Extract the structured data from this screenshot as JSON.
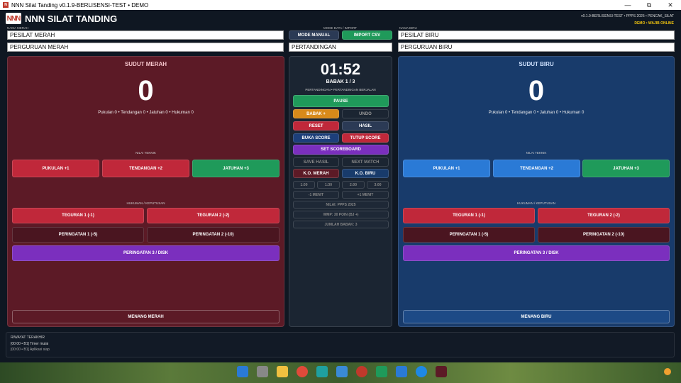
{
  "window": {
    "title": "NNN Silat Tanding v0.1.9-BERLISENSI-TEST • DEMO",
    "min": "—",
    "max": "⧉",
    "close": "✕"
  },
  "header": {
    "logo": "NNN",
    "app_name": "NNN SILAT TANDING",
    "meta1": "v0.1.9-BERLISENSI-TEST • PPPS 2025 • PENCAK_SILAT",
    "meta2": "DEMO • WAJIB ONLINE"
  },
  "left_fields": {
    "label": "NAMA MERAH",
    "name": "PESILAT MERAH",
    "club": "PERGURUAN MERAH"
  },
  "right_fields": {
    "label": "NAMA BIRU",
    "name": "PESILAT BIRU",
    "club": "PERGURUAN BIRU"
  },
  "mode": {
    "label": "MODE DATA / IMPORT",
    "manual": "MODE MANUAL",
    "import": "IMPORT CSV",
    "event": "PERTANDINGAN"
  },
  "red": {
    "title": "SUDUT MERAH",
    "score": "0",
    "stats": "Pukulan 0  •  Tendangan 0  •  Jatuhan 0  •  Hukuman 0",
    "teknik_label": "NILAI TEKNIK",
    "pukulan": "PUKULAN +1",
    "tendangan": "TENDANGAN +2",
    "jatuhan": "JATUHAN +3",
    "hukuman_label": "HUKUMAN / KEPUTUSAN",
    "teguran1": "TEGURAN 1  (-1)",
    "teguran2": "TEGURAN 2  (-2)",
    "peringatan1": "PERINGATAN 1  (-5)",
    "peringatan2": "PERINGATAN 2  (-10)",
    "peringatan3": "PERINGATAN 3 / DISK",
    "menang": "MENANG MERAH"
  },
  "blue": {
    "title": "SUDUT BIRU",
    "score": "0",
    "stats": "Pukulan 0  •  Tendangan 0  •  Jatuhan 0  •  Hukuman 0",
    "teknik_label": "NILAI TEKNIK",
    "pukulan": "PUKULAN +1",
    "tendangan": "TENDANGAN +2",
    "jatuhan": "JATUHAN +3",
    "hukuman_label": "HUKUMAN / KEPUTUSAN",
    "teguran1": "TEGURAN 1  (-1)",
    "teguran2": "TEGURAN 2  (-2)",
    "peringatan1": "PERINGATAN 1  (-5)",
    "peringatan2": "PERINGATAN 2  (-10)",
    "peringatan3": "PERINGATAN 3 / DISK",
    "menang": "MENANG BIRU"
  },
  "center": {
    "timer": "01:52",
    "babak": "BABAK 1 / 3",
    "subtitle": "PERTANDINGAN • PERTANDINGAN BERJALAN",
    "pause": "PAUSE",
    "babak_plus": "BABAK +",
    "undo": "UNDO",
    "reset": "RESET",
    "hasil": "HASIL",
    "buka_score": "BUKA SCORE",
    "tutup_score": "TUTUP SCORE",
    "set_scoreboard": "SET SCOREBOARD",
    "save_hasil": "SAVE HASIL",
    "next_match": "NEXT MATCH",
    "ko_merah": "K.O. MERAH",
    "ko_biru": "K.O. BIRU",
    "t1": "1:00",
    "t2": "1:30",
    "t3": "2:00",
    "t4": "3:00",
    "minus": "-1 MENIT",
    "plus": "+1 MENIT",
    "nilai": "NILAI: PPPS 2025",
    "wmp": "WMP: 30 POIN (BJ +)",
    "jumlah": "JUMLAH BABAK: 3"
  },
  "riwayat": {
    "title": "RIWAYAT TERAKHIR",
    "lines": [
      "[00:00 • B1] Timer mulai",
      "[00:00 • B1] Aplikasi siap"
    ]
  },
  "colors": {
    "red_panel": "#5c1a26",
    "blue_panel": "#183b6b",
    "red_btn": "#c0283a",
    "blue_btn": "#2a7ad6",
    "green_btn": "#1f9a5a",
    "purple_btn": "#7b2fbe",
    "orange_btn": "#d88a1a"
  }
}
